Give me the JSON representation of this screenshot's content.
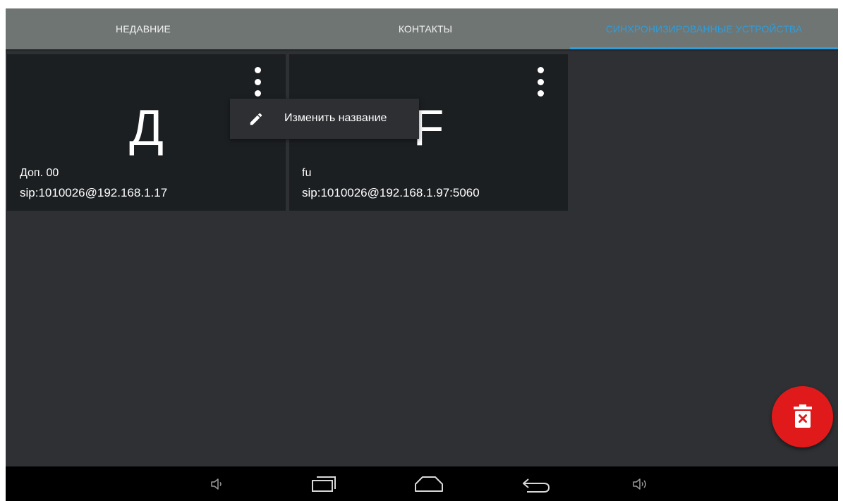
{
  "tabs": [
    {
      "label": "НЕДАВНИЕ",
      "active": false
    },
    {
      "label": "КОНТАКТЫ",
      "active": false
    },
    {
      "label": "СИНХРОНИЗИРОВАННЫЕ УСТРОЙСТВА",
      "active": true
    }
  ],
  "colors": {
    "accent": "#2f9ddc",
    "tabbar_bg": "#6f7572",
    "content_bg": "#2e3034",
    "card_bg": "#1c1f22",
    "fab_bg": "#e01a1a",
    "navbar_bg": "#000000"
  },
  "devices": [
    {
      "letter": "Д",
      "name": "Доп. 00",
      "address": "sip:1010026@192.168.1.17",
      "menu_icon": "more-vert-icon"
    },
    {
      "letter": "F",
      "name": "fu",
      "address": "sip:1010026@192.168.1.97:5060",
      "menu_icon": "more-vert-icon"
    }
  ],
  "popup_menu": {
    "icon": "pencil-icon",
    "item_label": "Изменить название"
  },
  "fab": {
    "icon": "delete-icon"
  },
  "navbar": {
    "icons": [
      "volume-down-icon",
      "recent-apps-icon",
      "home-icon",
      "back-icon",
      "volume-up-icon"
    ]
  }
}
